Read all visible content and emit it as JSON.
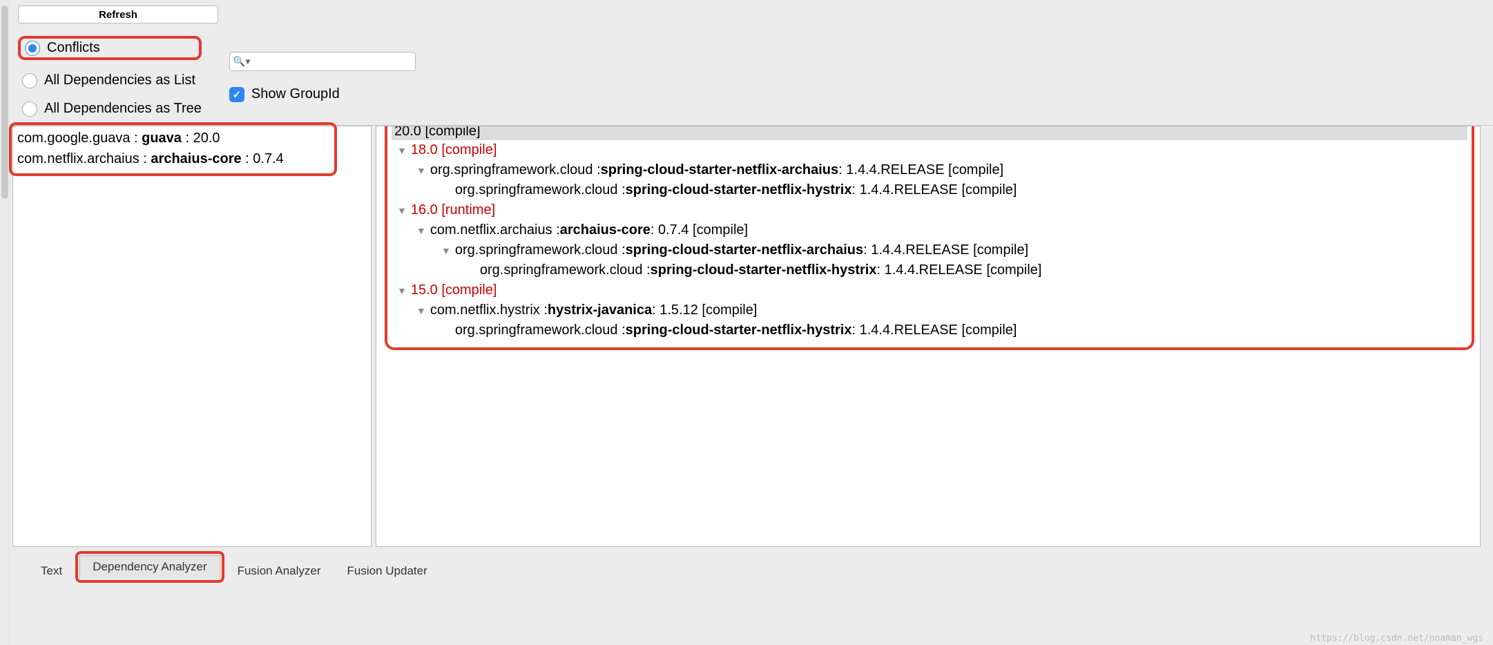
{
  "toolbar": {
    "refresh_label": "Refresh"
  },
  "filters": {
    "conflicts_label": "Conflicts",
    "all_list_label": "All Dependencies as List",
    "all_tree_label": "All Dependencies as Tree",
    "show_groupid_label": "Show GroupId",
    "search_placeholder": ""
  },
  "conflict_list": [
    {
      "group": "com.google.guava",
      "artifact": "guava",
      "version": "20.0"
    },
    {
      "group": "com.netflix.archaius",
      "artifact": "archaius-core",
      "version": "0.7.4"
    }
  ],
  "tree": {
    "selected_header": "20.0 [compile]",
    "nodes": [
      {
        "ver": "18.0 [compile]",
        "children": [
          {
            "text_pre": "org.springframework.cloud : ",
            "bold": "spring-cloud-starter-netflix-archaius",
            "text_post": " : 1.4.4.RELEASE [compile]",
            "children": [
              {
                "text_pre": "org.springframework.cloud : ",
                "bold": "spring-cloud-starter-netflix-hystrix",
                "text_post": " : 1.4.4.RELEASE [compile]"
              }
            ]
          }
        ]
      },
      {
        "ver": "16.0 [runtime]",
        "children": [
          {
            "text_pre": "com.netflix.archaius : ",
            "bold": "archaius-core",
            "text_post": " : 0.7.4 [compile]",
            "children": [
              {
                "text_pre": "org.springframework.cloud : ",
                "bold": "spring-cloud-starter-netflix-archaius",
                "text_post": " : 1.4.4.RELEASE [compile]",
                "children": [
                  {
                    "text_pre": "org.springframework.cloud : ",
                    "bold": "spring-cloud-starter-netflix-hystrix",
                    "text_post": " : 1.4.4.RELEASE [compile]"
                  }
                ]
              }
            ]
          }
        ]
      },
      {
        "ver": "15.0 [compile]",
        "children": [
          {
            "text_pre": "com.netflix.hystrix : ",
            "bold": "hystrix-javanica",
            "text_post": " : 1.5.12 [compile]",
            "children": [
              {
                "text_pre": "org.springframework.cloud : ",
                "bold": "spring-cloud-starter-netflix-hystrix",
                "text_post": " : 1.4.4.RELEASE [compile]"
              }
            ]
          }
        ]
      }
    ]
  },
  "tabs": {
    "text": "Text",
    "dep_analyzer": "Dependency Analyzer",
    "fusion_analyzer": "Fusion Analyzer",
    "fusion_updater": "Fusion Updater"
  },
  "watermark": "https://blog.csdn.net/noaman_wgs"
}
